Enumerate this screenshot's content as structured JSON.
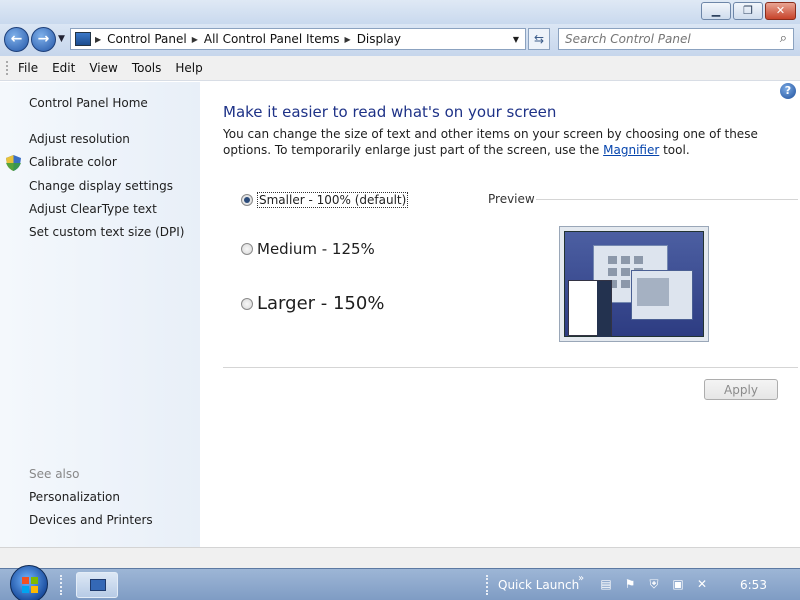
{
  "window": {
    "minimize_icon": "minimize-icon",
    "maximize_icon": "restore-icon",
    "close_icon": "close-icon"
  },
  "nav": {
    "back_icon": "back-arrow-icon",
    "forward_icon": "forward-arrow-icon",
    "breadcrumb": [
      "Control Panel",
      "All Control Panel Items",
      "Display"
    ],
    "search_placeholder": "Search Control Panel"
  },
  "menu": [
    "File",
    "Edit",
    "View",
    "Tools",
    "Help"
  ],
  "sidebar": {
    "home": "Control Panel Home",
    "links": [
      "Adjust resolution",
      "Calibrate color",
      "Change display settings",
      "Adjust ClearType text",
      "Set custom text size (DPI)"
    ],
    "see_also_label": "See also",
    "see_also": [
      "Personalization",
      "Devices and Printers"
    ]
  },
  "main": {
    "title": "Make it easier to read what's on your screen",
    "description_pre": "You can change the size of text and other items on your screen by choosing one of these options. To temporarily enlarge just part of the screen, use the ",
    "description_link": "Magnifier",
    "description_post": " tool.",
    "options": [
      {
        "label": "Smaller - 100% (default)",
        "checked": true
      },
      {
        "label": "Medium - 125%",
        "checked": false
      },
      {
        "label": "Larger - 150%",
        "checked": false
      }
    ],
    "preview_label": "Preview",
    "apply_label": "Apply"
  },
  "taskbar": {
    "quick_launch": "Quick Launch",
    "clock": "6:53"
  }
}
